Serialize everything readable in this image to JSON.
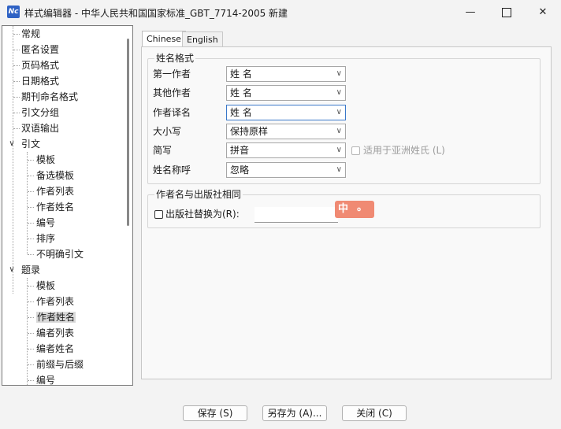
{
  "window": {
    "icon_text": "Nc",
    "title": "样式编辑器 - 中华人民共和国国家标准_GBT_7714-2005 新建",
    "minimize_glyph": "—",
    "close_glyph": "✕"
  },
  "tree": {
    "items": [
      {
        "label": "常规"
      },
      {
        "label": "匿名设置"
      },
      {
        "label": "页码格式"
      },
      {
        "label": "日期格式"
      },
      {
        "label": "期刊命名格式"
      },
      {
        "label": "引文分组"
      },
      {
        "label": "双语输出"
      },
      {
        "label": "引文"
      },
      {
        "label": "模板"
      },
      {
        "label": "备选模板"
      },
      {
        "label": "作者列表"
      },
      {
        "label": "作者姓名"
      },
      {
        "label": "编号"
      },
      {
        "label": "排序"
      },
      {
        "label": "不明确引文"
      },
      {
        "label": "题录"
      },
      {
        "label": "模板"
      },
      {
        "label": "作者列表"
      },
      {
        "label": "作者姓名"
      },
      {
        "label": "编者列表"
      },
      {
        "label": "编者姓名"
      },
      {
        "label": "前缀与后缀"
      },
      {
        "label": "编号"
      }
    ],
    "expand_glyph": "∨"
  },
  "tabs": [
    {
      "label": "Chinese"
    },
    {
      "label": "English"
    }
  ],
  "name_format": {
    "title": "姓名格式",
    "rows": [
      {
        "label": "第一作者",
        "value": "姓 名"
      },
      {
        "label": "其他作者",
        "value": "姓 名"
      },
      {
        "label": "作者译名",
        "value": "姓 名"
      },
      {
        "label": "大小写",
        "value": "保持原样"
      },
      {
        "label": "简写",
        "value": "拼音"
      },
      {
        "label": "姓名称呼",
        "value": "忽略"
      }
    ],
    "asian_checkbox_label": "适用于亚洲姓氏 (L)",
    "arrow_glyph": "∨"
  },
  "publisher": {
    "title": "作者名与出版社相同",
    "checkbox_label": "出版社替换为(R):",
    "input_value": ""
  },
  "ime": {
    "char": "中",
    "dot": "。"
  },
  "buttons": {
    "save": "保存 (S)",
    "save_as": "另存为 (A)...",
    "close": "关闭 (C)"
  }
}
